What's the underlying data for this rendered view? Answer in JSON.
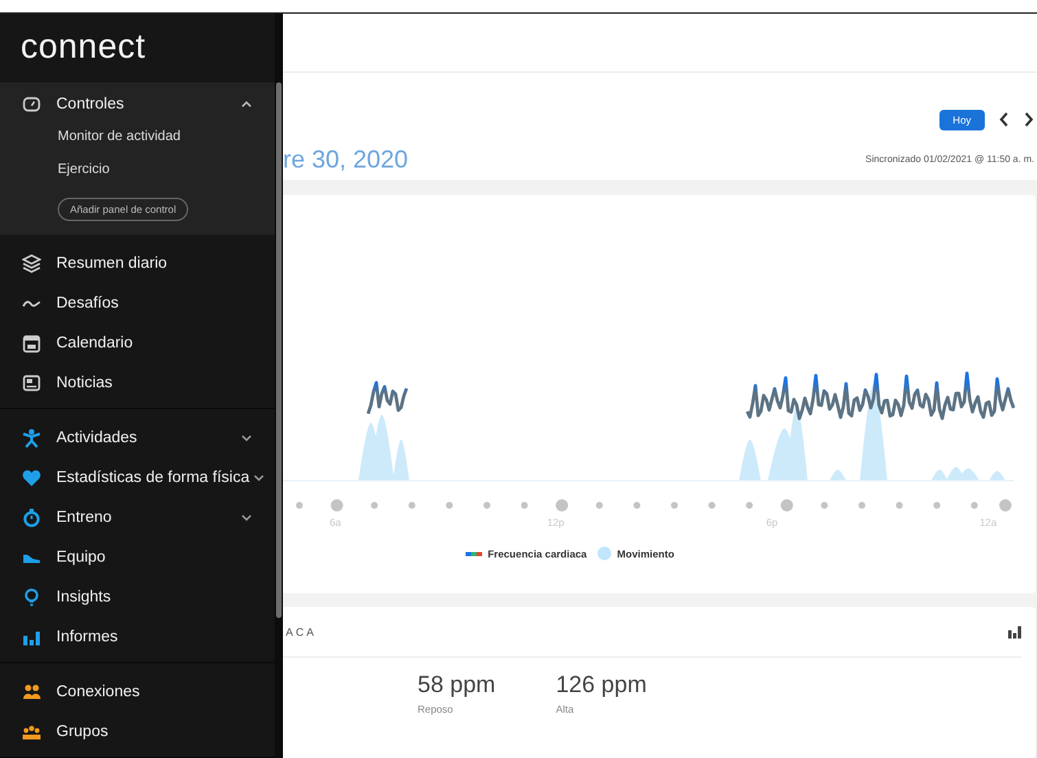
{
  "sidebar": {
    "logo": "connect",
    "dashboards": {
      "label": "Controles",
      "expanded": true,
      "items": [
        "Monitor de actividad",
        "Ejercicio"
      ],
      "button": "Añadir panel de control"
    },
    "groups": [
      {
        "items": [
          {
            "label": "Resumen diario"
          },
          {
            "label": "Desafíos"
          },
          {
            "label": "Calendario"
          },
          {
            "label": "Noticias"
          }
        ]
      },
      {
        "items": [
          {
            "label": "Actividades",
            "expanded": false
          },
          {
            "label": "Estadísticas de forma física",
            "expanded": false
          },
          {
            "label": "Entreno",
            "expanded": false
          },
          {
            "label": "Equipo"
          },
          {
            "label": "Insights"
          },
          {
            "label": "Informes"
          }
        ]
      },
      {
        "items": [
          {
            "label": "Conexiones"
          },
          {
            "label": "Grupos"
          }
        ]
      }
    ]
  },
  "header": {
    "today_button": "Hoy",
    "date_title": "re 30, 2020",
    "sync_status": "Sincronizado 01/02/2021 @ 11:50 a. m."
  },
  "chart_card": {
    "x_labels": [
      "6a",
      "12p",
      "6p",
      "12a"
    ],
    "legend": [
      {
        "label": "Frecuencia cardiaca",
        "kind": "line"
      },
      {
        "label": "Movimiento",
        "kind": "area"
      }
    ]
  },
  "heart_card": {
    "title": "ACA",
    "stats": [
      {
        "value": "58 ppm",
        "label": "Reposo"
      },
      {
        "value": "126 ppm",
        "label": "Alta"
      }
    ]
  }
}
